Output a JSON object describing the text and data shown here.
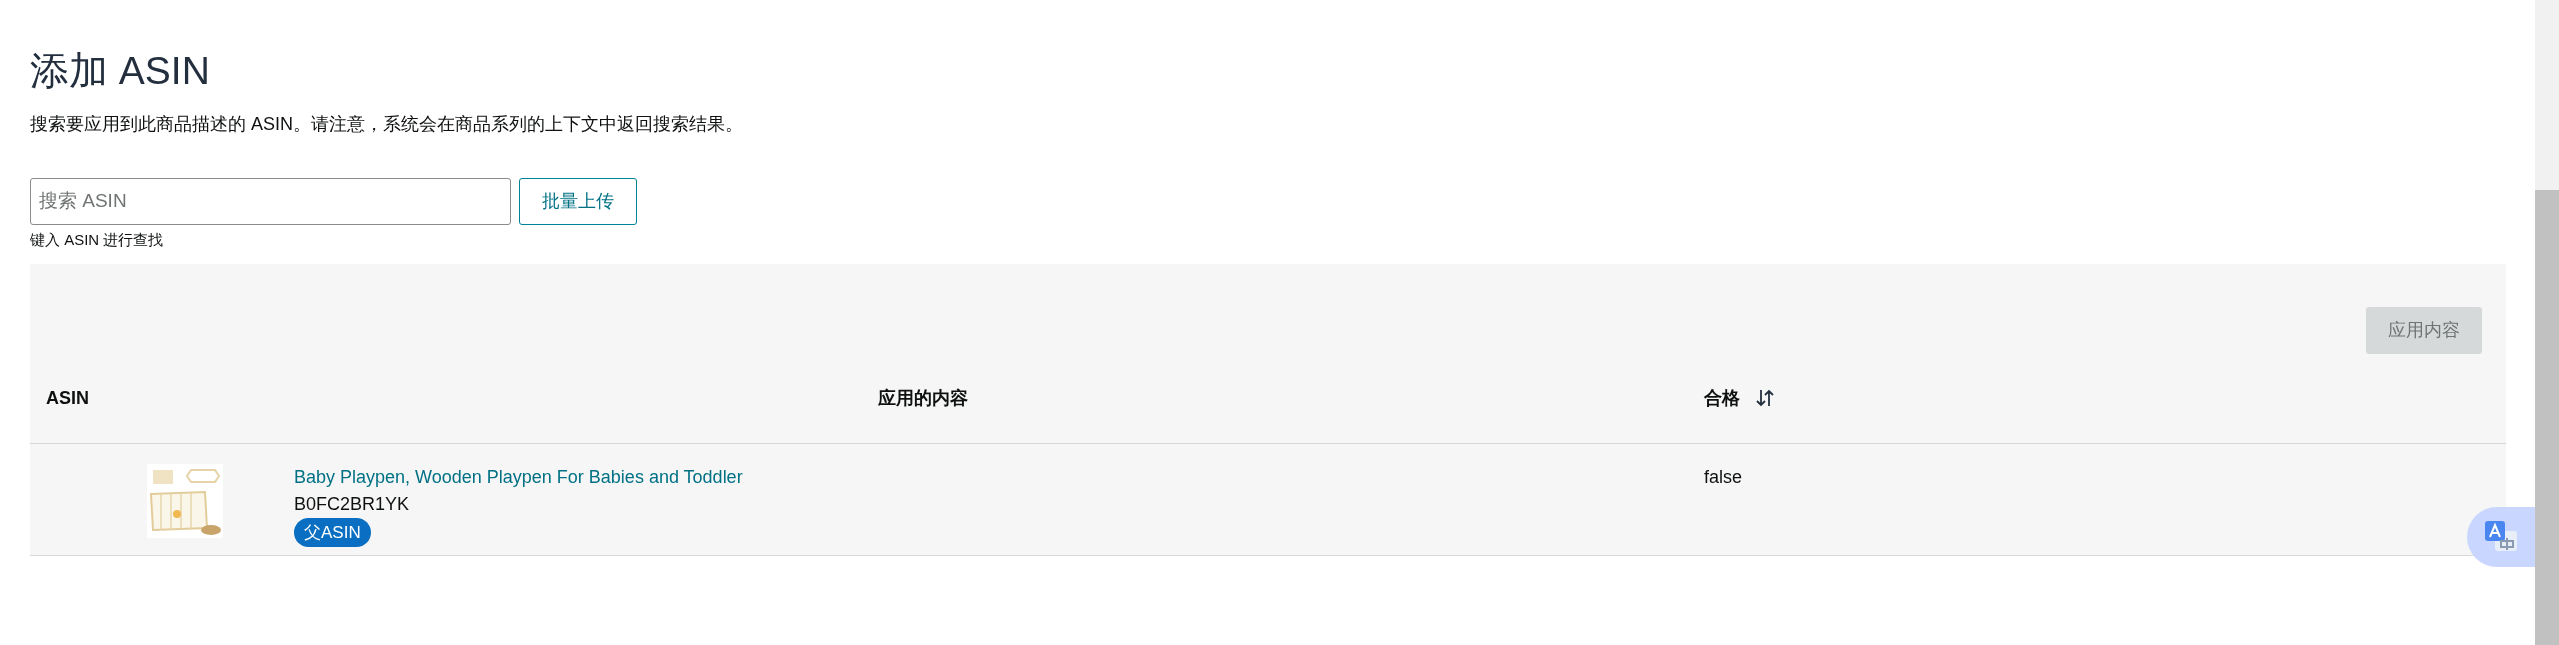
{
  "title": "添加 ASIN",
  "description": "搜索要应用到此商品描述的 ASIN。请注意，系统会在商品系列的上下文中返回搜索结果。",
  "search": {
    "placeholder": "搜索 ASIN",
    "hint": "键入 ASIN 进行查找"
  },
  "bulk_upload_button": "批量上传",
  "apply_button": {
    "label": "应用内容",
    "disabled": true
  },
  "table": {
    "columns": [
      {
        "label": "ASIN"
      },
      {
        "label": "应用的内容"
      },
      {
        "label": "合格",
        "sortable": true
      }
    ],
    "rows": [
      {
        "title": "Baby Playpen, Wooden Playpen For Babies and Toddler",
        "asin": "B0FC2BR1YK",
        "badge": "父ASIN",
        "eligible": "false"
      }
    ]
  }
}
